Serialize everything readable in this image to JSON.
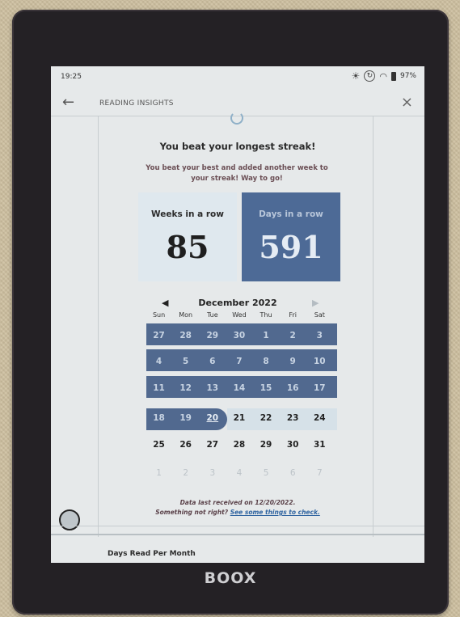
{
  "status": {
    "time": "19:25",
    "battery": "97%"
  },
  "header": {
    "title": "READING INSIGHTS"
  },
  "message": {
    "title": "You beat your longest streak!",
    "body": "You beat your best and added another week to your streak! Way to go!"
  },
  "streaks": {
    "weeks": {
      "label": "Weeks in a row",
      "value": "85"
    },
    "days": {
      "label": "Days in a row",
      "value": "591"
    }
  },
  "calendar": {
    "month": "December 2022",
    "dow": [
      "Sun",
      "Mon",
      "Tue",
      "Wed",
      "Thu",
      "Fri",
      "Sat"
    ],
    "rows": [
      [
        "27",
        "28",
        "29",
        "30",
        "1",
        "2",
        "3"
      ],
      [
        "4",
        "5",
        "6",
        "7",
        "8",
        "9",
        "10"
      ],
      [
        "11",
        "12",
        "13",
        "14",
        "15",
        "16",
        "17"
      ],
      [
        "18",
        "19",
        "20",
        "21",
        "22",
        "23",
        "24"
      ],
      [
        "25",
        "26",
        "27",
        "28",
        "29",
        "30",
        "31"
      ],
      [
        "1",
        "2",
        "3",
        "4",
        "5",
        "6",
        "7"
      ]
    ]
  },
  "note": {
    "line1": "Data last received on 12/20/2022.",
    "line2_prefix": "Something not right? ",
    "link": "See some things to check."
  },
  "section": {
    "title": "Days Read Per Month"
  },
  "device": {
    "brand": "BOOX"
  },
  "colors": {
    "streak_band": "#51698f",
    "days_box": "#4d6a96",
    "weeks_box": "#dfe8ee"
  }
}
